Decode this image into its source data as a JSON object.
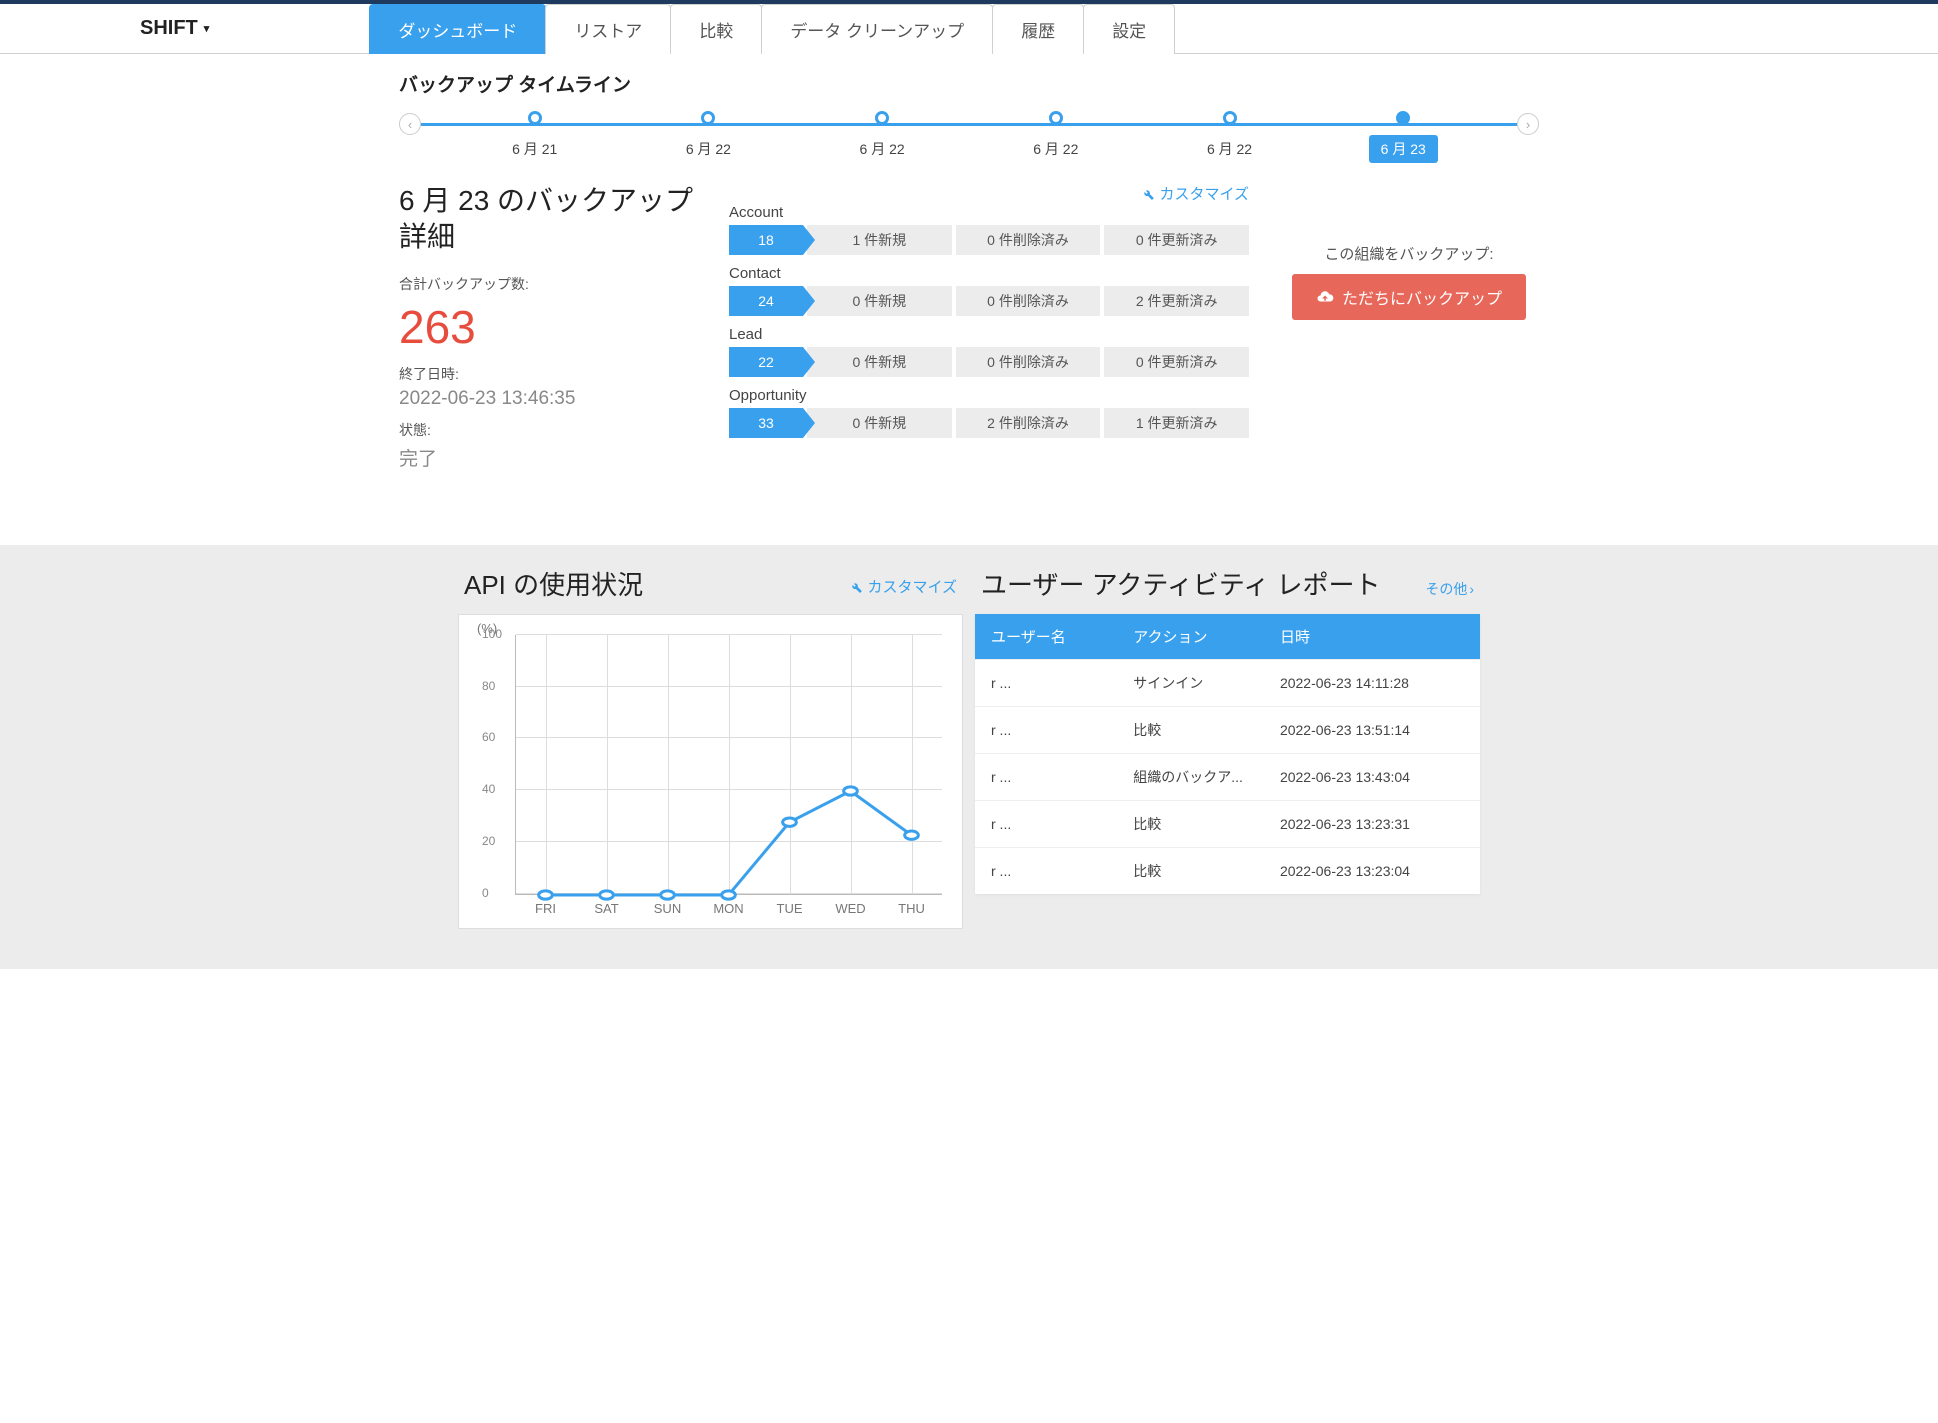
{
  "brand": "SHIFT",
  "nav": {
    "tabs": [
      "ダッシュボード",
      "リストア",
      "比較",
      "データ クリーンアップ",
      "履歴",
      "設定"
    ],
    "active_index": 0
  },
  "timeline": {
    "title": "バックアップ タイムライン",
    "points": [
      "6 月 21",
      "6 月 22",
      "6 月 22",
      "6 月 22",
      "6 月 22",
      "6 月 23"
    ],
    "active_index": 5
  },
  "details": {
    "title": "6 月 23 のバックアップ詳細",
    "customize_label": "カスタマイズ",
    "total_label": "合計バックアップ数:",
    "total_value": "263",
    "finished_label": "終了日時:",
    "finished_value": "2022-06-23 13:46:35",
    "status_label": "状態:",
    "status_value": "完了",
    "objects": [
      {
        "name": "Account",
        "count": "18",
        "new": "1 件新規",
        "deleted": "0 件削除済み",
        "updated": "0 件更新済み"
      },
      {
        "name": "Contact",
        "count": "24",
        "new": "0 件新規",
        "deleted": "0 件削除済み",
        "updated": "2 件更新済み"
      },
      {
        "name": "Lead",
        "count": "22",
        "new": "0 件新規",
        "deleted": "0 件削除済み",
        "updated": "0 件更新済み"
      },
      {
        "name": "Opportunity",
        "count": "33",
        "new": "0 件新規",
        "deleted": "2 件削除済み",
        "updated": "1 件更新済み"
      }
    ],
    "side": {
      "hint": "この組織をバックアップ:",
      "button": "ただちにバックアップ"
    }
  },
  "api_usage": {
    "title": "API の使用状況",
    "customize_label": "カスタマイズ"
  },
  "chart_data": {
    "type": "line",
    "ylabel": "(%)",
    "ylim": [
      0,
      100
    ],
    "yticks": [
      0,
      20,
      40,
      60,
      80,
      100
    ],
    "categories": [
      "FRI",
      "SAT",
      "SUN",
      "MON",
      "TUE",
      "WED",
      "THU"
    ],
    "values": [
      0,
      0,
      0,
      0,
      28,
      40,
      23
    ]
  },
  "activity": {
    "title": "ユーザー アクティビティ レポート",
    "more_label": "その他",
    "columns": [
      "ユーザー名",
      "アクション",
      "日時"
    ],
    "rows": [
      {
        "user": "r                     ...",
        "action": "サインイン",
        "time": "2022-06-23 14:11:28"
      },
      {
        "user": "r                     ...",
        "action": "比較",
        "time": "2022-06-23 13:51:14"
      },
      {
        "user": "r                     ...",
        "action": "組織のバックア...",
        "time": "2022-06-23 13:43:04"
      },
      {
        "user": "r                     ...",
        "action": "比較",
        "time": "2022-06-23 13:23:31"
      },
      {
        "user": "r                     ...",
        "action": "比較",
        "time": "2022-06-23 13:23:04"
      }
    ]
  }
}
